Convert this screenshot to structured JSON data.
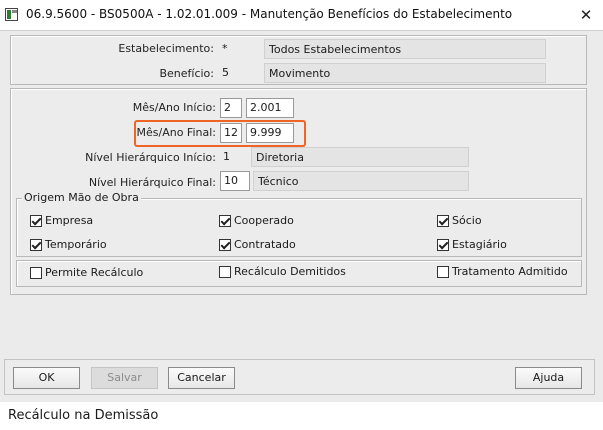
{
  "window": {
    "title": "06.9.5600 - BS0500A - 1.02.01.009 - Manutenção Benefícios do Estabelecimento",
    "close_glyph": "✕",
    "app_icon": "window-app-icon"
  },
  "header": {
    "estabelecimento_label": "Estabelecimento:",
    "estabelecimento_code": "*",
    "estabelecimento_desc": "Todos Estabelecimentos",
    "beneficio_label": "Benefício:",
    "beneficio_code": "5",
    "beneficio_desc": "Movimento"
  },
  "params": {
    "inicio_label": "Mês/Ano Início:",
    "inicio_mes": "2",
    "inicio_ano": "2.001",
    "final_label": "Mês/Ano Final:",
    "final_mes": "12",
    "final_ano": "9.999",
    "nivel_inicio_label": "Nível Hierárquico Início:",
    "nivel_inicio_code": "1",
    "nivel_inicio_desc": "Diretoria",
    "nivel_final_label": "Nível Hierárquico Final:",
    "nivel_final_code": "10",
    "nivel_final_desc": "Técnico"
  },
  "origem": {
    "legend": "Origem Mão de Obra",
    "items": [
      {
        "label": "Empresa",
        "checked": true
      },
      {
        "label": "Cooperado",
        "checked": true
      },
      {
        "label": "Sócio",
        "checked": true
      },
      {
        "label": "Temporário",
        "checked": true
      },
      {
        "label": "Contratado",
        "checked": true
      },
      {
        "label": "Estagiário",
        "checked": true
      }
    ]
  },
  "options": {
    "items": [
      {
        "label": "Permite Recálculo",
        "checked": false
      },
      {
        "label": "Recálculo Demitidos",
        "checked": false
      },
      {
        "label": "Tratamento Admitido",
        "checked": false
      }
    ]
  },
  "buttons": {
    "ok": "OK",
    "salvar": "Salvar",
    "cancelar": "Cancelar",
    "ajuda": "Ajuda"
  },
  "status": {
    "text": "Recálculo na Demissão"
  },
  "colors": {
    "highlight": "#f06426",
    "window_bg": "#ebebeb"
  }
}
